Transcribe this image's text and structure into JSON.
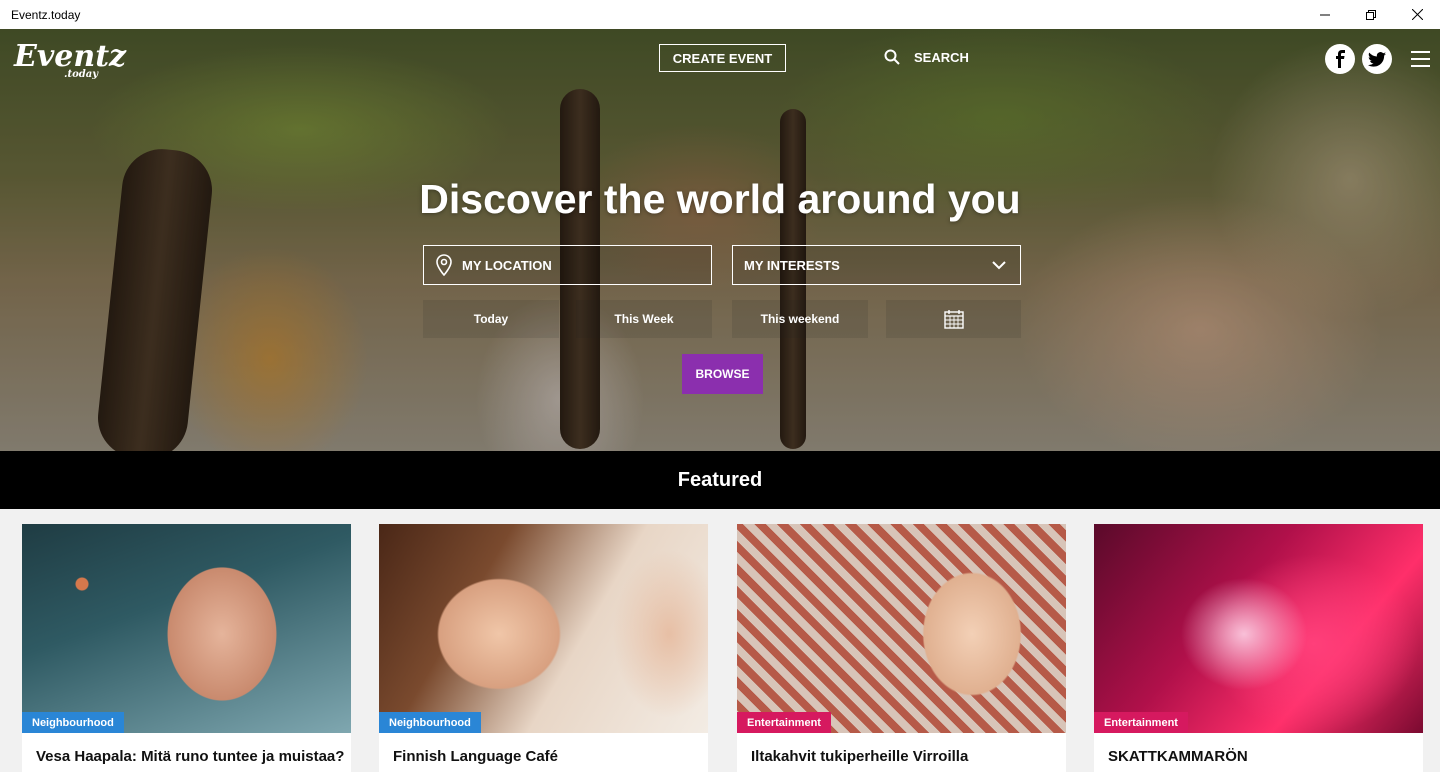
{
  "window": {
    "title": "Eventz.today"
  },
  "header": {
    "logo_main": "Eventz",
    "logo_sub": ".today",
    "create_event_label": "CREATE EVENT",
    "search_label": "SEARCH"
  },
  "hero": {
    "headline": "Discover the world around you",
    "location_label": "MY LOCATION",
    "interests_label": "MY INTERESTS",
    "date_filters": [
      "Today",
      "This Week",
      "This weekend"
    ],
    "browse_label": "BROWSE"
  },
  "featured": {
    "heading": "Featured",
    "cards": [
      {
        "category": "Neighbourhood",
        "category_color": "#2a86d6",
        "title": "Vesa Haapala: Mitä runo tuntee ja muistaa?"
      },
      {
        "category": "Neighbourhood",
        "category_color": "#2a86d6",
        "title": "Finnish Language Café"
      },
      {
        "category": "Entertainment",
        "category_color": "#d6195f",
        "title": "Iltakahvit tukiperheille Virroilla"
      },
      {
        "category": "Entertainment",
        "category_color": "#d6195f",
        "title": "SKATTKAMMARÖN"
      }
    ]
  },
  "colors": {
    "browse": "#8b2fae",
    "featured_bar": "#000000"
  }
}
